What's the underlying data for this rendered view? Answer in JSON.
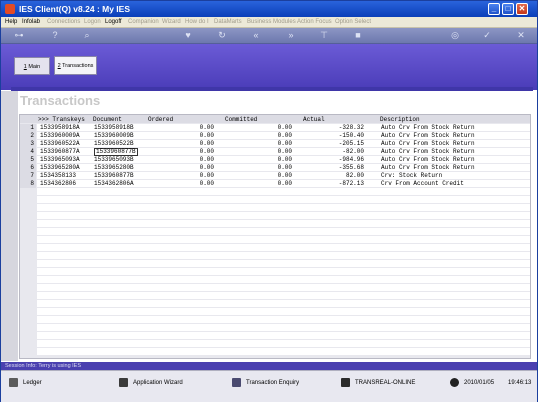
{
  "window": {
    "title": "IES Client(Q) v8.24 : My IES",
    "min": "_",
    "max": "□",
    "close": "✕"
  },
  "menu": [
    {
      "label": "Help",
      "on": true
    },
    {
      "label": "Infolab",
      "on": true
    },
    {
      "label": "Connections",
      "on": false
    },
    {
      "label": "Logon",
      "on": false
    },
    {
      "label": "Logoff",
      "on": true
    },
    {
      "label": "Companion",
      "on": false
    },
    {
      "label": "Wizard",
      "on": false
    },
    {
      "label": "How do I",
      "on": false
    },
    {
      "label": "DataMarts",
      "on": false
    },
    {
      "label": "Business Modules",
      "on": false
    },
    {
      "label": "Action Focus",
      "on": false
    },
    {
      "label": "Option Select",
      "on": false
    }
  ],
  "tabs": {
    "main_num": "1",
    "main_label": " Main",
    "trans_num": "2",
    "trans_label": " Transactions"
  },
  "page_title": "Transactions",
  "grid": {
    "headers": [
      ">>> Transkeys",
      "Document",
      "Ordered",
      "Committed",
      "Actual",
      "Description"
    ],
    "rows": [
      {
        "n": "1",
        "key": "1533958918A",
        "doc": "1533958918B",
        "ord": "0.00",
        "com": "0.00",
        "act": "-328.32",
        "desc": "Auto Crv From Stock Return"
      },
      {
        "n": "2",
        "key": "1533960009A",
        "doc": "1533960009B",
        "ord": "0.00",
        "com": "0.00",
        "act": "-150.40",
        "desc": "Auto Crv From Stock Return"
      },
      {
        "n": "3",
        "key": "1533960522A",
        "doc": "1533960522B",
        "ord": "0.00",
        "com": "0.00",
        "act": "-205.15",
        "desc": "Auto Crv From Stock Return"
      },
      {
        "n": "4",
        "key": "1533960877A",
        "doc": "1533960877B",
        "ord": "0.00",
        "com": "0.00",
        "act": "-82.00",
        "desc": "Auto Crv From Stock Return"
      },
      {
        "n": "5",
        "key": "1533965093A",
        "doc": "1533965093B",
        "ord": "0.00",
        "com": "0.00",
        "act": "-984.96",
        "desc": "Auto Crv From Stock Return"
      },
      {
        "n": "6",
        "key": "1533965280A",
        "doc": "1533965280B",
        "ord": "0.00",
        "com": "0.00",
        "act": "-355.68",
        "desc": "Auto Crv From Stock Return"
      },
      {
        "n": "7",
        "key": "1534358133",
        "doc": "1533960877B",
        "ord": "0.00",
        "com": "0.00",
        "act": "82.00",
        "desc": "Crv: Stock Return"
      },
      {
        "n": "8",
        "key": "1534362806",
        "doc": "1534362806A",
        "ord": "0.00",
        "com": "0.00",
        "act": "-872.13",
        "desc": "Crv From Account Credit"
      }
    ]
  },
  "session_info": "Session Info: Terry is using IES",
  "status": {
    "ledger": "Ledger",
    "wizard": "Application Wizard",
    "enquiry": "Transaction Enquiry",
    "server": "TRANSREAL-ONLINE",
    "date": "2010/01/05",
    "time": "19:46:13"
  },
  "colors": {
    "title_bar": "#0a3fb8",
    "purple_band": "#4a3cb8",
    "toolbar": "#7a84b8"
  },
  "toolbar_icons": [
    "key-icon",
    "help-icon",
    "search-icon",
    "heart-icon",
    "refresh-icon",
    "rewind-icon",
    "forward-icon",
    "pin-icon",
    "stop-icon",
    "globe-icon",
    "check-icon",
    "close-icon"
  ]
}
